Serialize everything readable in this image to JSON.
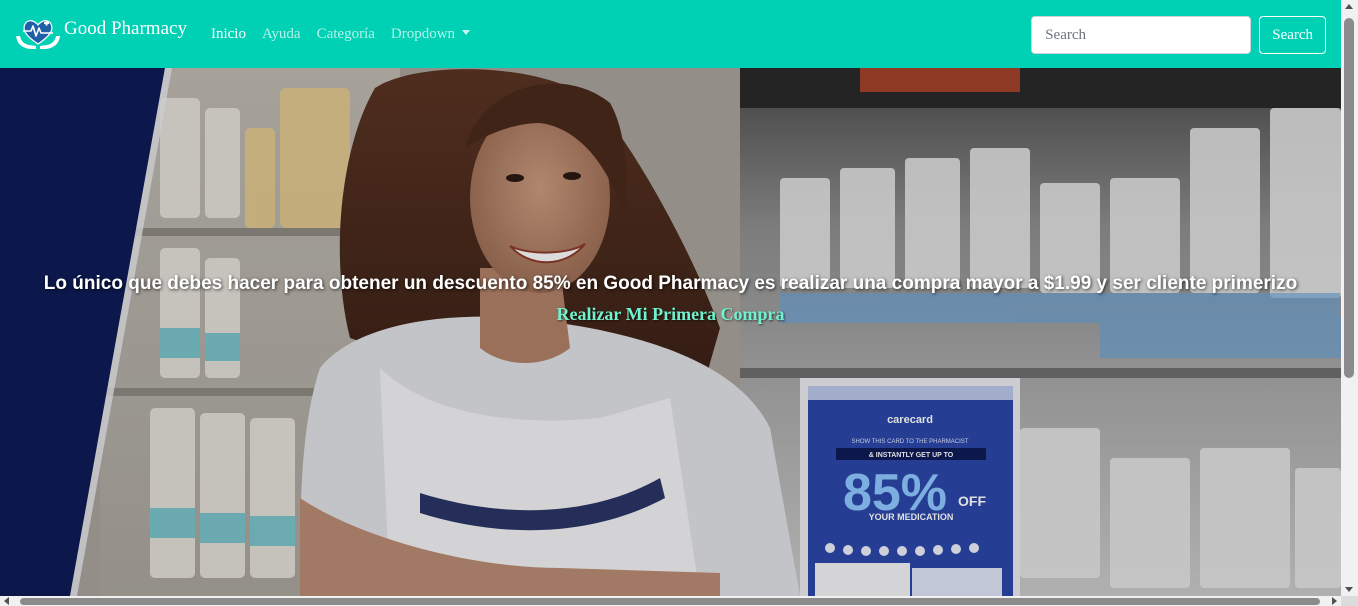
{
  "navbar": {
    "brand_name": "Good Pharmacy",
    "brand_logo_icon": "hands-heart-pulse-icon",
    "links": [
      {
        "label": "Inicio",
        "active": true
      },
      {
        "label": "Ayuda",
        "active": false
      },
      {
        "label": "Categoría",
        "active": false
      },
      {
        "label": "Dropdown",
        "active": false,
        "has_caret": true
      }
    ],
    "search": {
      "placeholder": "Search",
      "value": "",
      "button_label": "Search"
    },
    "bg_color": "#00d1b5"
  },
  "hero": {
    "headline": "Lo único que debes hacer para obtener un descuento 85% en Good Pharmacy es realizar una compra mayor a $1.99 y ser cliente primerizo",
    "cta_label": "Realizar Mi Primera Compra",
    "cta_color": "#6ff2cf",
    "promo_card": {
      "brand": "carecard",
      "top_text": "SHOW THIS CARD TO THE PHARMACIST",
      "sub_text": "& INSTANTLY GET UP TO",
      "percent": "85%",
      "off": "OFF",
      "line": "YOUR MEDICATION"
    }
  }
}
